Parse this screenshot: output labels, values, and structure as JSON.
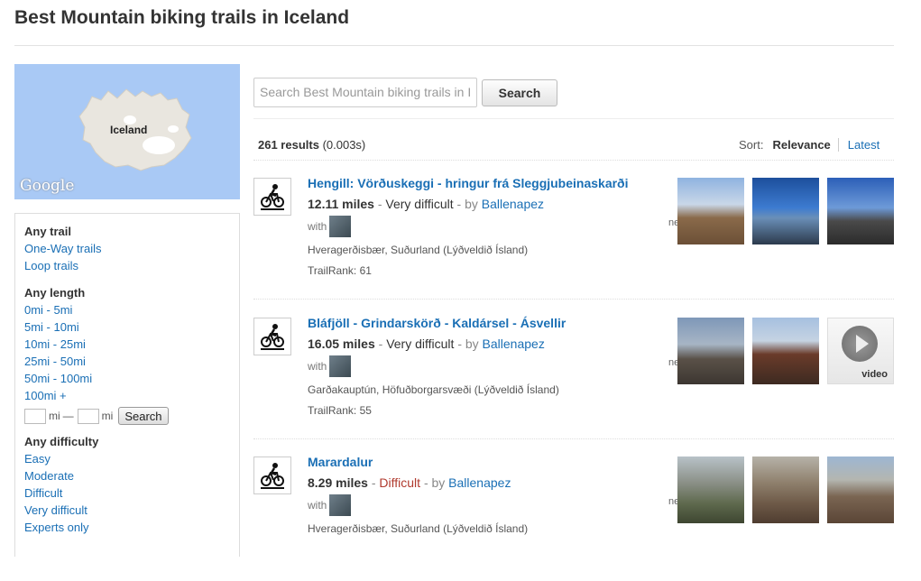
{
  "page": {
    "title": "Best Mountain biking trails in Iceland"
  },
  "map": {
    "label": "Iceland",
    "provider": "Google"
  },
  "filters": {
    "trail": {
      "heading": "Any trail",
      "options": [
        "One-Way trails",
        "Loop trails"
      ]
    },
    "length": {
      "heading": "Any length",
      "options": [
        "0mi - 5mi",
        "5mi - 10mi",
        "10mi - 25mi",
        "25mi - 50mi",
        "50mi - 100mi",
        "100mi +"
      ],
      "range_unit": "mi",
      "range_dash": "—",
      "range_button": "Search"
    },
    "difficulty": {
      "heading": "Any difficulty",
      "options": [
        "Easy",
        "Moderate",
        "Difficult",
        "Very difficult",
        "Experts only"
      ]
    }
  },
  "search": {
    "placeholder": "Search Best Mountain biking trails in I",
    "button": "Search"
  },
  "results": {
    "count": "261 results",
    "time": "(0.003s)",
    "sort_label": "Sort:",
    "sort_active": "Relevance",
    "sort_other": "Latest"
  },
  "trails": [
    {
      "name": "Hengill: Vörðuskeggi - hringur frá Sleggjubeinaskarði",
      "distance": "12.11 miles",
      "difficulty": "Very difficult",
      "by_label": "- by",
      "author": "Ballenapez",
      "with_label": "with",
      "location": "Hveragerðisbær, Suðurland (Lýðveldið Ísland)",
      "trailrank": "TrailRank: 61",
      "ne": "ne"
    },
    {
      "name": "Bláfjöll - Grindarskörð - Kaldársel - Ásvellir",
      "distance": "16.05 miles",
      "difficulty": "Very difficult",
      "by_label": "- by",
      "author": "Ballenapez",
      "with_label": "with",
      "location": "Garðakauptún, Höfuðborgarsvæði (Lýðveldið Ísland)",
      "trailrank": "TrailRank: 55",
      "ne": "ne",
      "video_label": "video"
    },
    {
      "name": "Marardalur",
      "distance": "8.29 miles",
      "difficulty": "Difficult",
      "by_label": "- by",
      "author": "Ballenapez",
      "with_label": "with",
      "location": "Hveragerðisbær, Suðurland (Lýðveldið Ísland)",
      "ne": "ne"
    }
  ],
  "colors": {
    "link": "#1a6fb5",
    "difficult": "#b03a2e",
    "map_water": "#a9c9f5"
  }
}
